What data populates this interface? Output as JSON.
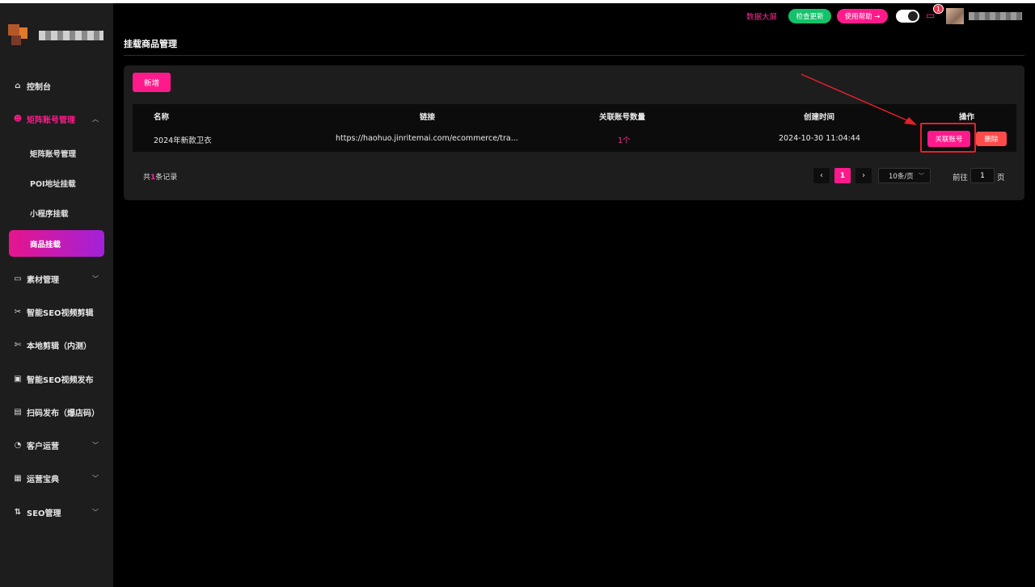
{
  "header": {
    "data_screen_label": "数据大屏",
    "check_update_label": "检查更新",
    "help_label": "使用帮助 →",
    "notification_count": "1"
  },
  "sidebar": {
    "items": [
      {
        "label": "控制台",
        "icon": "home-icon"
      },
      {
        "label": "矩阵账号管理",
        "icon": "smile-icon",
        "expanded": true
      },
      {
        "label": "素材管理",
        "icon": "folder-icon"
      },
      {
        "label": "智能SEO视频剪辑",
        "icon": "scissors-icon"
      },
      {
        "label": "本地剪辑（内测）",
        "icon": "cut-icon"
      },
      {
        "label": "智能SEO视频发布",
        "icon": "video-icon"
      },
      {
        "label": "扫码发布（爆店码）",
        "icon": "qr-icon"
      },
      {
        "label": "客户运营",
        "icon": "pie-icon"
      },
      {
        "label": "运营宝典",
        "icon": "book-icon"
      },
      {
        "label": "SEO管理",
        "icon": "sort-icon"
      }
    ],
    "sub_items": [
      {
        "label": "矩阵账号管理"
      },
      {
        "label": "POI地址挂载"
      },
      {
        "label": "小程序挂载"
      },
      {
        "label": "商品挂载",
        "selected": true
      }
    ]
  },
  "page": {
    "title": "挂载商品管理",
    "add_button": "新增"
  },
  "table": {
    "columns": [
      "名称",
      "链接",
      "关联账号数量",
      "创建时间",
      "操作"
    ],
    "rows": [
      {
        "name": "2024年新款卫衣",
        "link": "https://haohuo.jinritemai.com/ecommerce/tra...",
        "count": "1个",
        "created": "2024-10-30 11:04:44",
        "action_link": "关联账号",
        "action_delete": "删除"
      }
    ]
  },
  "pagination": {
    "total_prefix": "共",
    "total_num": "1",
    "total_suffix": "条记录",
    "prev": "‹",
    "current_page": "1",
    "next": "›",
    "page_size": "10条/页",
    "goto_prefix": "前往",
    "goto_value": "1",
    "goto_suffix": "页"
  },
  "colors": {
    "accent": "#ff1a8c",
    "success": "#13c26a",
    "danger": "#ff4a4a",
    "annotation": "#e4202a"
  }
}
